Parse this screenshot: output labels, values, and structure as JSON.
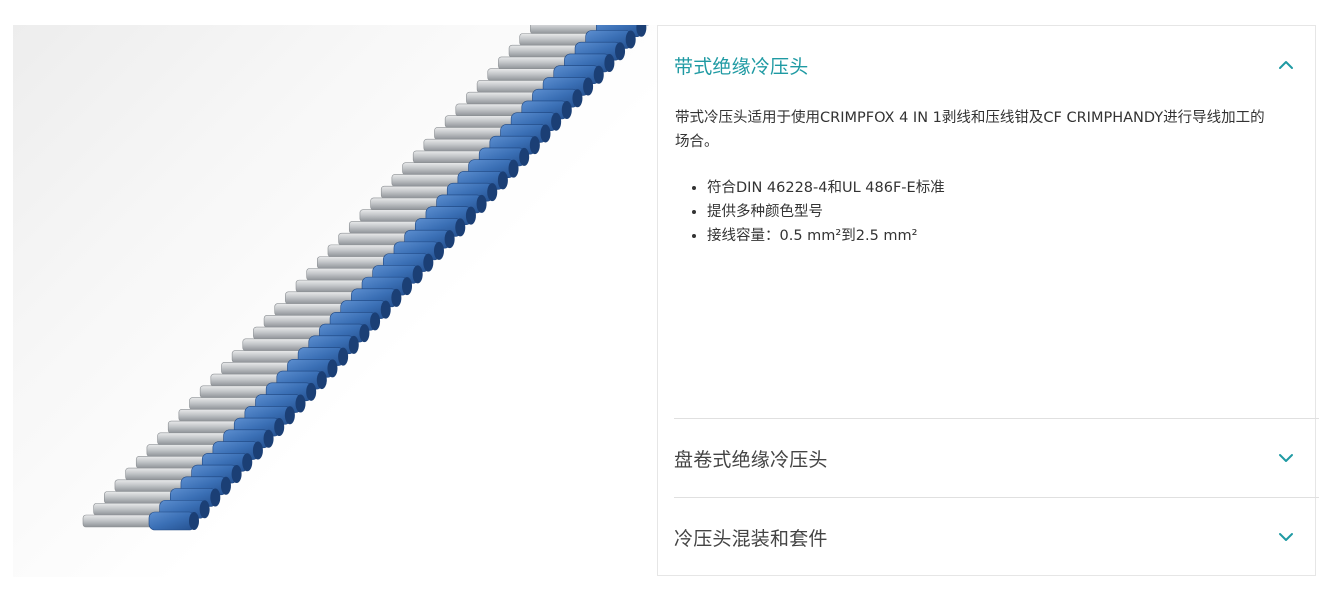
{
  "accordion": {
    "sections": [
      {
        "title": "带式绝缘冷压头",
        "expanded": true,
        "description": "带式冷压头适用于使用CRIMPFOX 4 IN 1剥线和压线钳及CF CRIMPHANDY进行导线加工的场合。",
        "bullets": [
          "符合DIN 46228-4和UL 486F-E标准",
          "提供多种颜色型号",
          "接线容量：0.5 mm²到2.5 mm²"
        ]
      },
      {
        "title": "盘卷式绝缘冷压头",
        "expanded": false
      },
      {
        "title": "冷压头混装和套件",
        "expanded": false
      }
    ]
  },
  "colors": {
    "accent": "#1f9aa3",
    "ferrule_blue": "#3a6fb5",
    "ferrule_metal": "#b9bcbf"
  },
  "product_image": {
    "icon": "ferrule-strip-image"
  }
}
